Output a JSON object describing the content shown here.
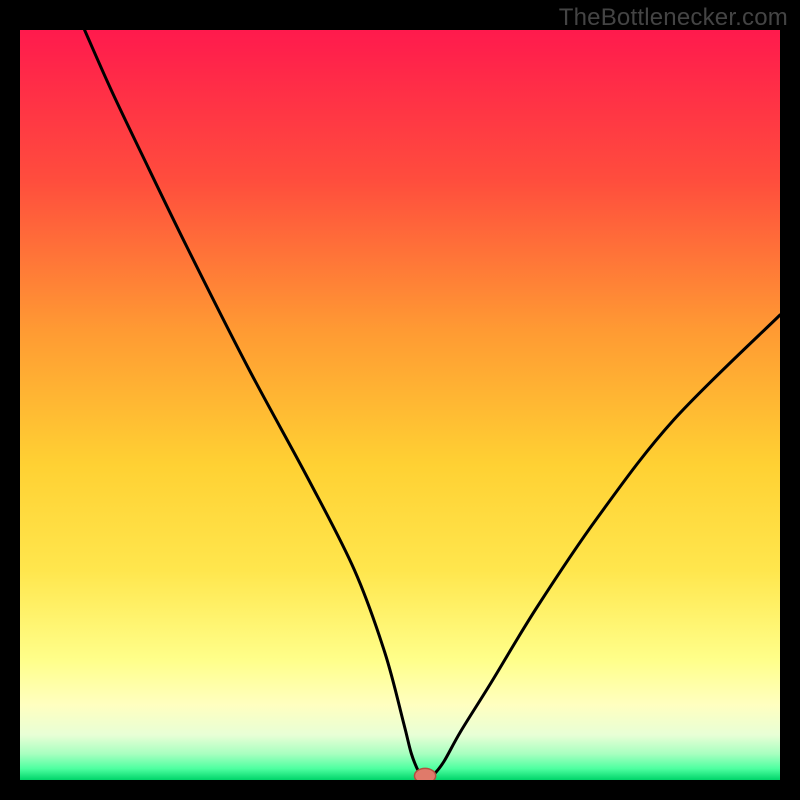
{
  "watermark": "TheBottlenecker.com",
  "chart_data": {
    "type": "line",
    "title": "",
    "xlabel": "",
    "ylabel": "",
    "xlim": [
      0,
      100
    ],
    "ylim": [
      0,
      100
    ],
    "grid": false,
    "legend": false,
    "gradient_stops": [
      {
        "offset": 0.0,
        "color": "#ff1a4d"
      },
      {
        "offset": 0.2,
        "color": "#ff4d3d"
      },
      {
        "offset": 0.4,
        "color": "#ff9a33"
      },
      {
        "offset": 0.58,
        "color": "#ffd133"
      },
      {
        "offset": 0.72,
        "color": "#ffe64d"
      },
      {
        "offset": 0.84,
        "color": "#ffff8a"
      },
      {
        "offset": 0.9,
        "color": "#ffffc0"
      },
      {
        "offset": 0.94,
        "color": "#e8ffd6"
      },
      {
        "offset": 0.965,
        "color": "#a8ffc0"
      },
      {
        "offset": 0.985,
        "color": "#4dffa0"
      },
      {
        "offset": 1.0,
        "color": "#00d46a"
      }
    ],
    "series": [
      {
        "name": "bottleneck-curve",
        "color": "#000000",
        "x": [
          8.5,
          12,
          16,
          22,
          30,
          38,
          44,
          48,
          50.5,
          51.5,
          52.5,
          53,
          53.8,
          54.5,
          55.8,
          58,
          62,
          68,
          76,
          86,
          100
        ],
        "y": [
          100,
          92,
          83.5,
          71,
          55,
          40,
          28,
          17,
          7.5,
          3.5,
          1.0,
          0.5,
          0.5,
          0.8,
          2.5,
          6.5,
          13,
          23,
          35,
          48,
          62
        ]
      }
    ],
    "marker": {
      "name": "selected-point",
      "x": 53.3,
      "y": 0.55,
      "rx": 1.4,
      "ry": 1.0,
      "fill": "#e07a6a",
      "stroke": "#b44f3f"
    }
  }
}
